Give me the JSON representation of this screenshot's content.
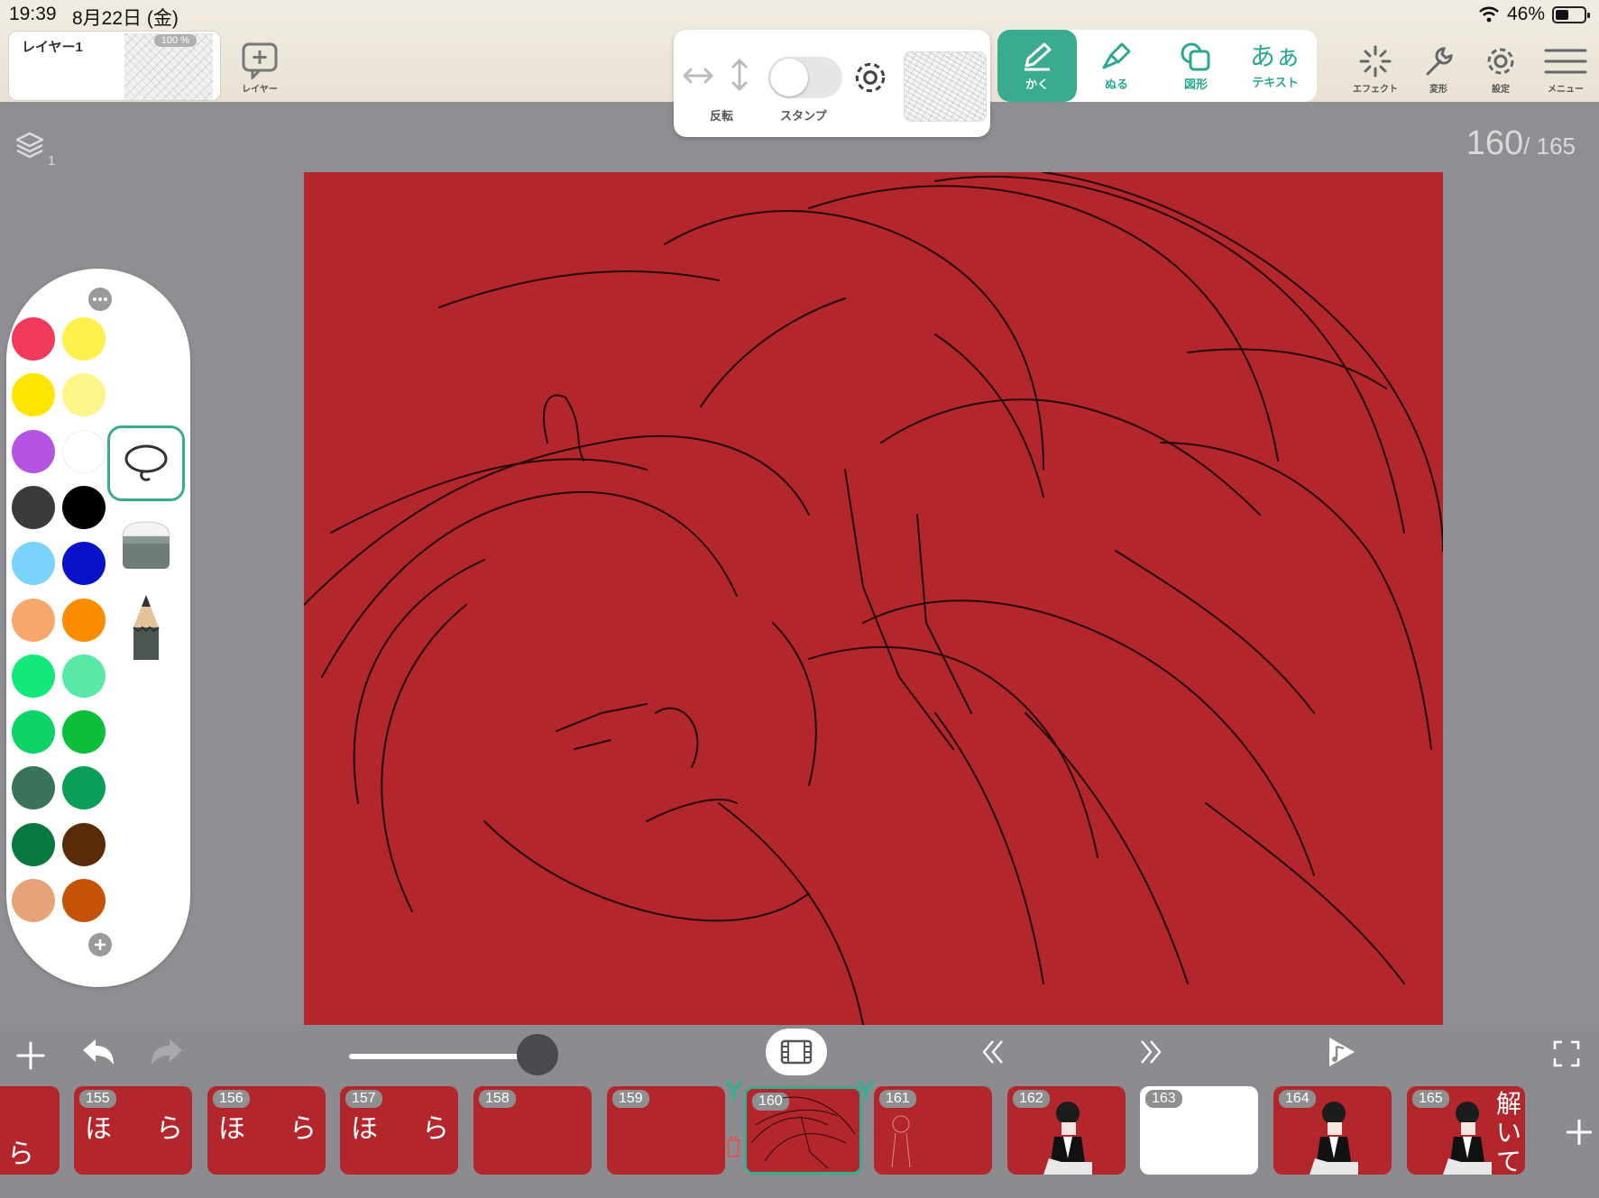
{
  "status_bar": {
    "time": "19:39",
    "date": "8月22日 (金)",
    "battery": "46%"
  },
  "layer_panel": {
    "layer_name": "レイヤー1",
    "opacity": "100 %",
    "add_layer_label": "レイヤー"
  },
  "sub_toolbar": {
    "flip_label": "反転",
    "stamp_label": "スタンプ"
  },
  "modes": {
    "draw": "かく",
    "fill": "ぬる",
    "shape": "図形",
    "text_glyph": "あぁ",
    "text": "テキスト"
  },
  "right_tools": {
    "effect": "エフェクト",
    "transform": "変形",
    "settings": "設定",
    "menu": "メニュー"
  },
  "canvas_info": {
    "layer_count": "1",
    "current_frame": "160",
    "total_frames": "/ 165"
  },
  "palette": {
    "colors": [
      "#f23b5c",
      "#fff14a",
      "#ffe600",
      "#fdf58a",
      "#b554e3",
      "#ffffff",
      "#3b3b3b",
      "#000000",
      "#7ad3fa",
      "#0a12c9",
      "#f7a66c",
      "#fb8c00",
      "#12e87c",
      "#5ae8a6",
      "#0ed366",
      "#0cbf3a",
      "#38735a",
      "#0a9e58",
      "#08783e",
      "#5a2b07",
      "#e6a279",
      "#c45308"
    ]
  },
  "frames": [
    {
      "num": "",
      "chars": [
        "ら"
      ]
    },
    {
      "num": "155",
      "chars": [
        "ほ",
        "ら"
      ]
    },
    {
      "num": "156",
      "chars": [
        "ほ",
        "ら"
      ]
    },
    {
      "num": "157",
      "chars": [
        "ほ",
        "ら"
      ]
    },
    {
      "num": "158",
      "chars": []
    },
    {
      "num": "159",
      "chars": []
    },
    {
      "num": "160",
      "chars": []
    },
    {
      "num": "161",
      "chars": []
    },
    {
      "num": "162",
      "chars": []
    },
    {
      "num": "163",
      "chars": []
    },
    {
      "num": "164",
      "chars": []
    },
    {
      "num": "165",
      "chars": [
        "解",
        "い",
        "て"
      ]
    }
  ]
}
